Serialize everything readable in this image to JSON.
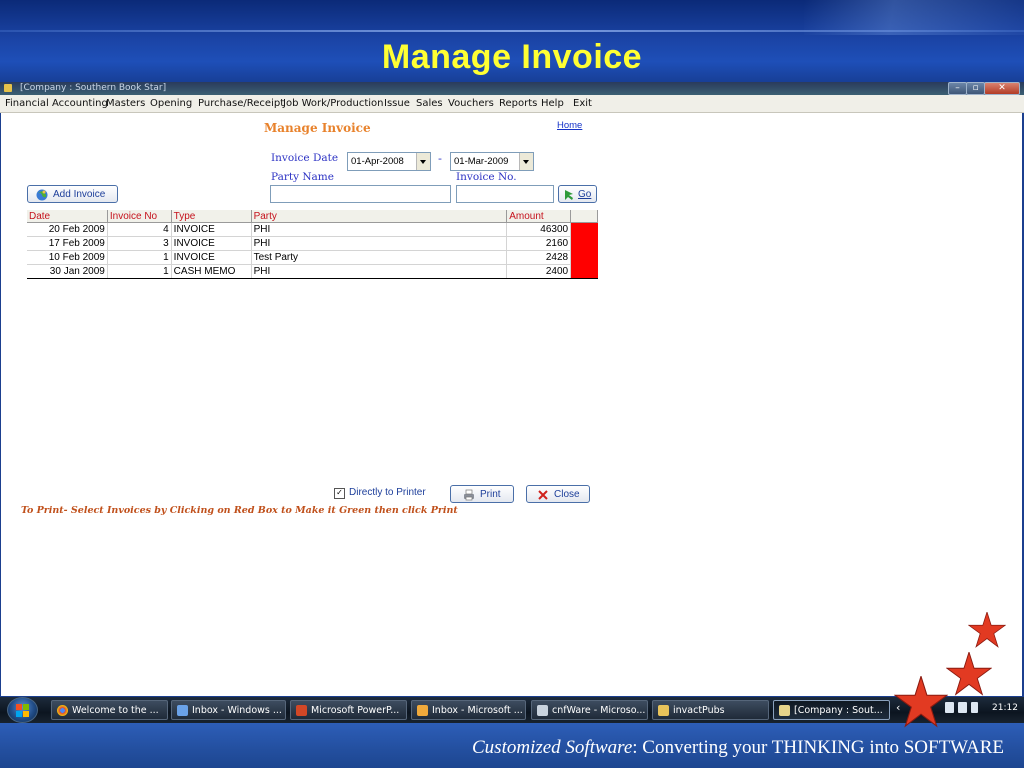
{
  "slide": {
    "title": "Manage Invoice",
    "tagline_italic": "Customized Software",
    "tagline_rest": ":   Converting your THINKING into SOFTWARE"
  },
  "window": {
    "caption": "[Company : Southern Book Star]",
    "buttons": [
      "minimize",
      "restore",
      "close"
    ]
  },
  "menu": [
    "Financial Accounting",
    "Masters",
    "Opening",
    "Purchase/Receipt",
    "Job Work/Production",
    "Issue",
    "Sales",
    "Vouchers",
    "Reports",
    "Help",
    "Exit"
  ],
  "form": {
    "heading": "Manage Invoice",
    "home_link": "Home",
    "invoice_date_label": "Invoice Date",
    "date_from": "01-Apr-2008",
    "date_separator": "-",
    "date_to": "01-Mar-2009",
    "party_name_label": "Party Name",
    "party_name_value": "",
    "invoice_no_label": "Invoice No.",
    "invoice_no_value": "",
    "go_label": "Go",
    "add_invoice_label": "Add Invoice"
  },
  "table": {
    "columns": [
      "Date",
      "Invoice No",
      "Type",
      "Party",
      "Amount",
      ""
    ],
    "rows": [
      {
        "date": "20 Feb 2009",
        "invoice_no": "4",
        "type": "INVOICE",
        "party": "PHI",
        "amount": "46300",
        "selected": false
      },
      {
        "date": "17 Feb 2009",
        "invoice_no": "3",
        "type": "INVOICE",
        "party": "PHI",
        "amount": "2160",
        "selected": false
      },
      {
        "date": "10 Feb 2009",
        "invoice_no": "1",
        "type": "INVOICE",
        "party": "Test Party",
        "amount": "2428",
        "selected": false
      },
      {
        "date": "30 Jan 2009",
        "invoice_no": "1",
        "type": "CASH MEMO",
        "party": "PHI",
        "amount": "2400",
        "selected": false
      }
    ],
    "select_box_color": "#ff0000"
  },
  "print": {
    "directly_to_printer_label": "Directly to Printer",
    "directly_to_printer_checked": true,
    "print_label": "Print",
    "close_label": "Close",
    "hint": "To Print- Select Invoices by Clicking on Red Box to Make it Green then click Print"
  },
  "taskbar": {
    "items": [
      {
        "label": "Welcome to the ...",
        "icon": "chrome-icon"
      },
      {
        "label": "Inbox - Windows ...",
        "icon": "mail-icon"
      },
      {
        "label": "Microsoft PowerP...",
        "icon": "powerpoint-icon"
      },
      {
        "label": "Inbox - Microsoft ...",
        "icon": "outlook-icon"
      },
      {
        "label": "cnfWare - Microso...",
        "icon": "pointer-icon"
      },
      {
        "label": "invactPubs",
        "icon": "folder-icon"
      },
      {
        "label": "[Company : Sout...",
        "icon": "app-icon"
      }
    ],
    "clock": "21:12"
  },
  "colors": {
    "banner_blue": "#1b44a6",
    "title_yellow": "#ffff33",
    "heading_orange": "#e8822c",
    "label_blue": "#2d33c4",
    "header_red": "#c5121c",
    "hint_orange": "#c0501b",
    "star_red": "#e23a22"
  }
}
